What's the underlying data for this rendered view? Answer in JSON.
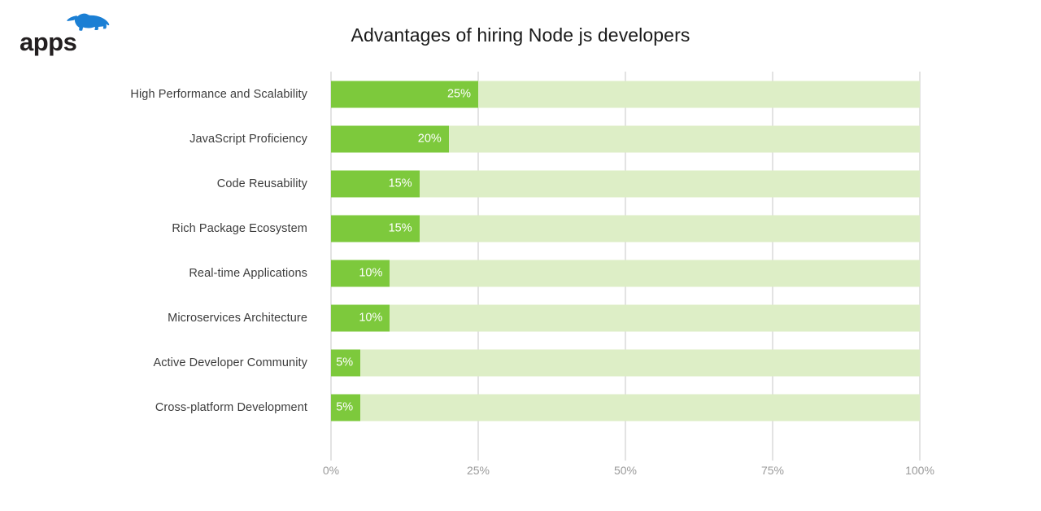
{
  "brand": {
    "wordmark": "apps",
    "mark_name": "rhino-logo",
    "wordmark_color": "#231f20",
    "mark_color": "#1b7fd4"
  },
  "chart_data": {
    "type": "bar",
    "orientation": "horizontal",
    "title": "Advantages of hiring Node js developers",
    "xlabel": "",
    "ylabel": "",
    "xlim": [
      0,
      100
    ],
    "grid": true,
    "legend": false,
    "categories": [
      "High Performance and Scalability",
      "JavaScript Proficiency",
      "Code Reusability",
      "Rich Package Ecosystem",
      "Real-time Applications",
      "Microservices Architecture",
      "Active Developer Community",
      "Cross-platform Development"
    ],
    "values": [
      25,
      20,
      15,
      15,
      10,
      10,
      5,
      5
    ],
    "value_labels": [
      "25%",
      "20%",
      "15%",
      "15%",
      "10%",
      "10%",
      "5%",
      "5%"
    ],
    "xticks": [
      0,
      25,
      50,
      75,
      100
    ],
    "xtick_labels": [
      "0%",
      "25%",
      "50%",
      "75%",
      "100%"
    ],
    "colors": {
      "bar": "#7dc93c",
      "track": "#ddeec6",
      "gridline": "#e3e3e3",
      "label": "#3c3c3c",
      "tick_label": "#9a9a9a",
      "value_label": "#ffffff"
    }
  }
}
